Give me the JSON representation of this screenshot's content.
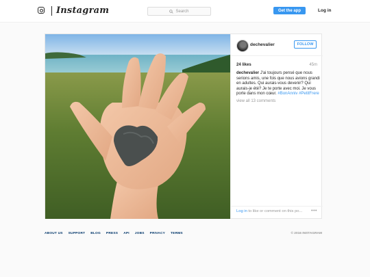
{
  "header": {
    "logo_text": "Instagram",
    "search_placeholder": "Search",
    "get_app_label": "Get the app",
    "login_label": "Log in"
  },
  "post": {
    "username": "dechevalier",
    "follow_label": "FOLLOW",
    "likes": "24 likes",
    "time_ago": "45m",
    "caption_user": "dechevalier",
    "caption_text": "J'ai toujours pensé que nous serions amis, une fois que nous avions grandi en adultes. Qui aurais-vous devenir? Qui aurais-je été? Je te porte avec moi. Je vous porte dans mon cœur.",
    "caption_tags": "#BonAnniv #PetitFrere",
    "view_all_comments": "view all 13 comments",
    "comment_login_link": "Log in",
    "comment_prompt_rest": " to like or comment on this po...",
    "more_options": "•••"
  },
  "footer": {
    "links": [
      "ABOUT US",
      "SUPPORT",
      "BLOG",
      "PRESS",
      "API",
      "JOBS",
      "PRIVACY",
      "TERMS"
    ],
    "copyright": "© 2016 INSTAGRAM"
  },
  "colors": {
    "accent": "#3897f0",
    "footer_link": "#003569",
    "muted": "#999999"
  },
  "icons": [
    "instagram-camera-icon",
    "search-icon",
    "more-options-icon"
  ]
}
